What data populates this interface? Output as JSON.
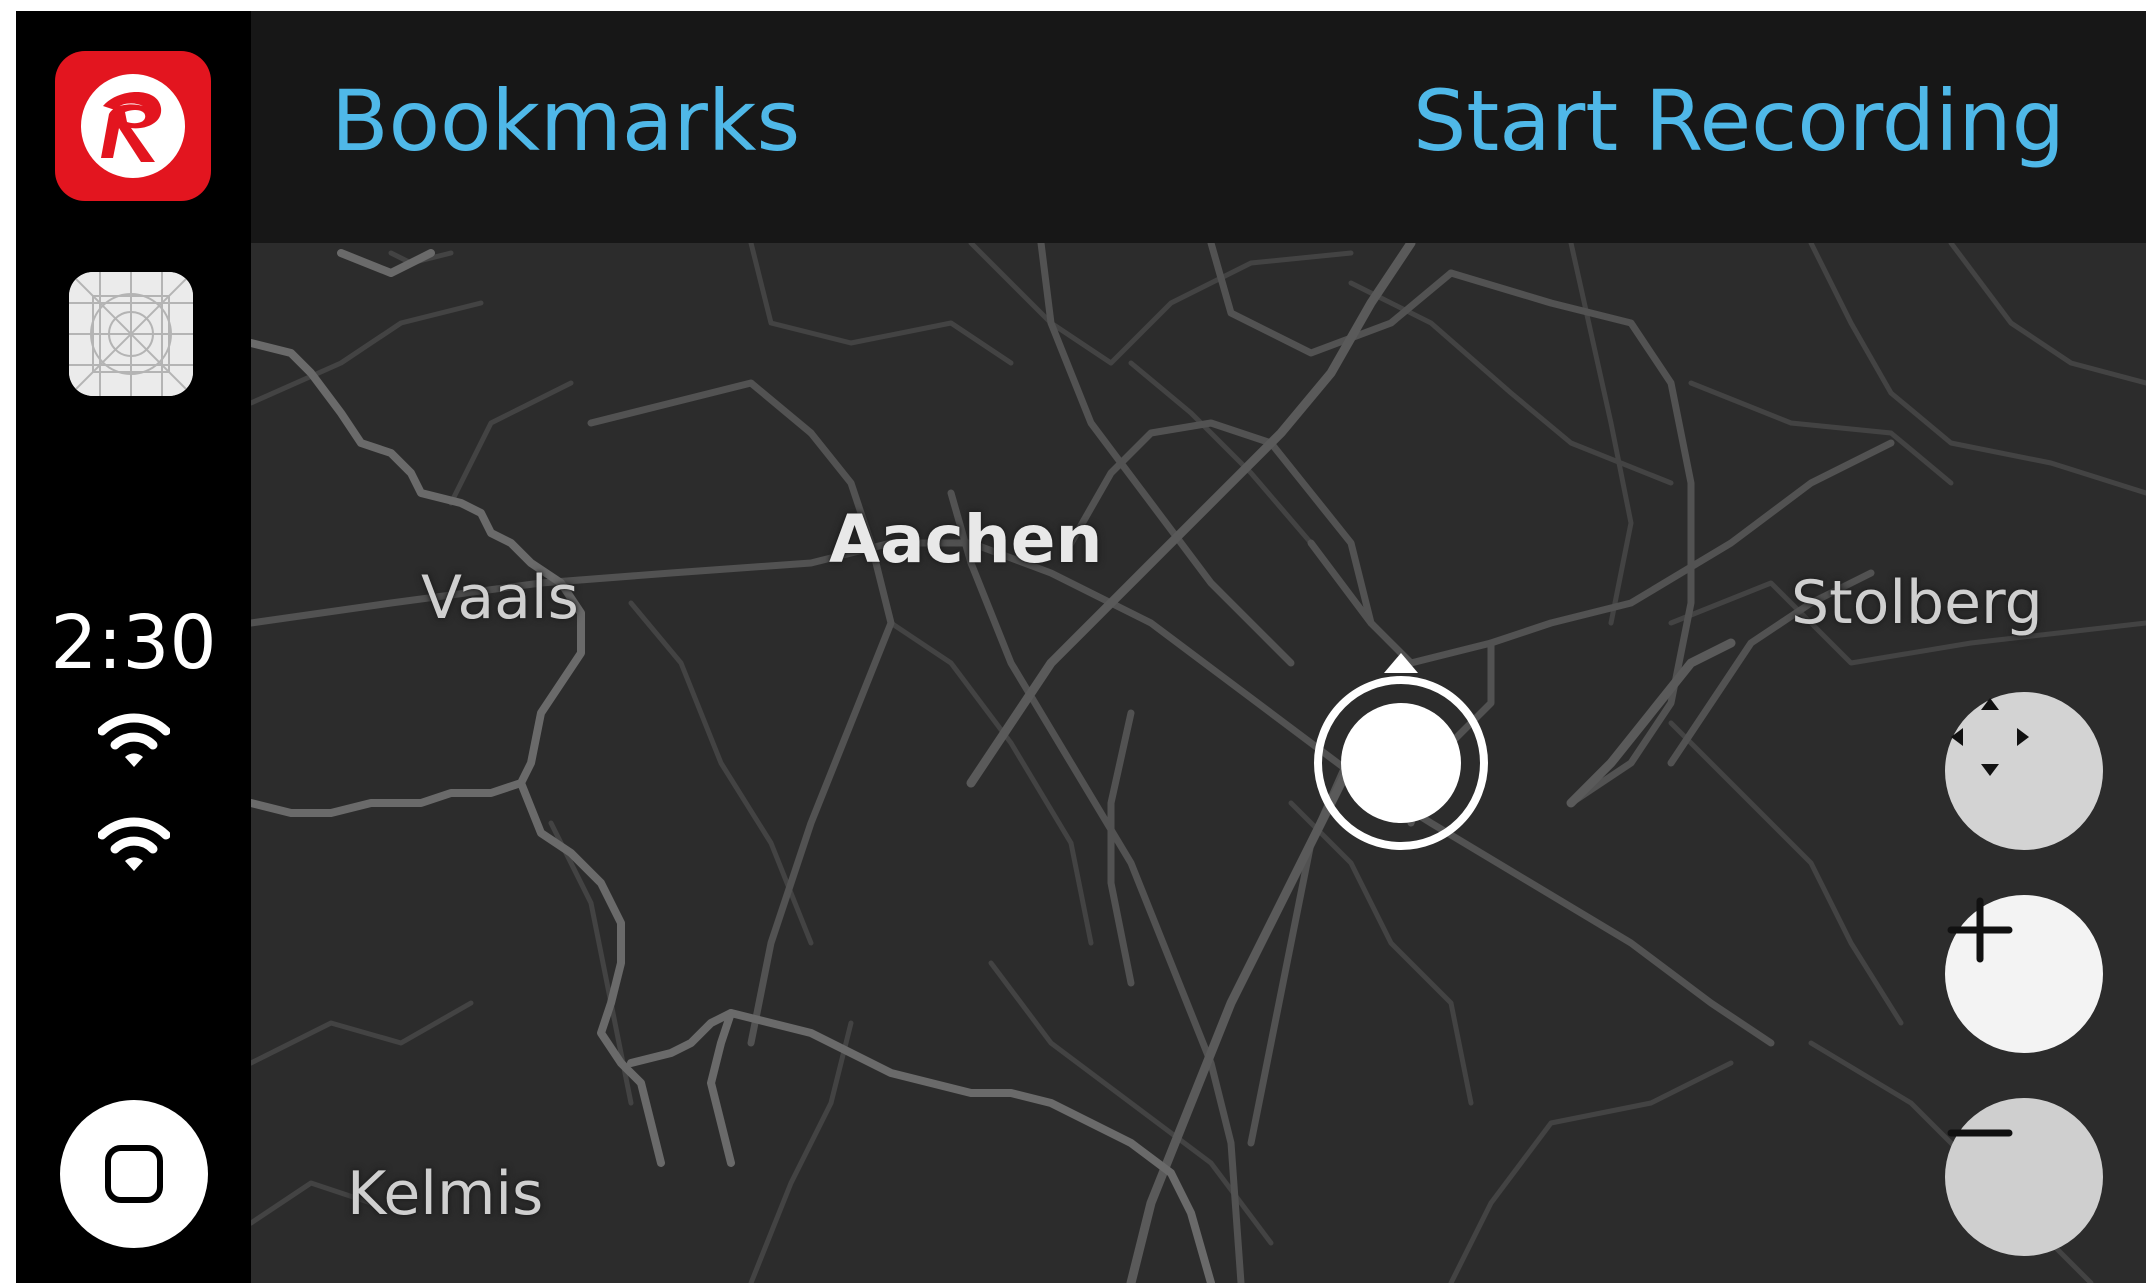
{
  "navbar": {
    "left_button": "Bookmarks",
    "right_button": "Start Recording",
    "accent_color": "#4fb8e8"
  },
  "sidebar": {
    "app_icon": "red-r-logo-icon",
    "map_app_icon": "map-grid-icon",
    "time": "2:30",
    "status_icons": [
      "wifi-icon",
      "wifi-icon"
    ],
    "home_icon": "home-button-icon"
  },
  "map": {
    "places": {
      "aachen": "Aachen",
      "vaals": "Vaals",
      "stolberg": "Stolberg",
      "kelmis": "Kelmis"
    },
    "location_marker": "current-location-icon",
    "controls": {
      "pan": "pan-arrows-icon",
      "zoom_in": "plus-icon",
      "zoom_out": "minus-icon"
    }
  }
}
